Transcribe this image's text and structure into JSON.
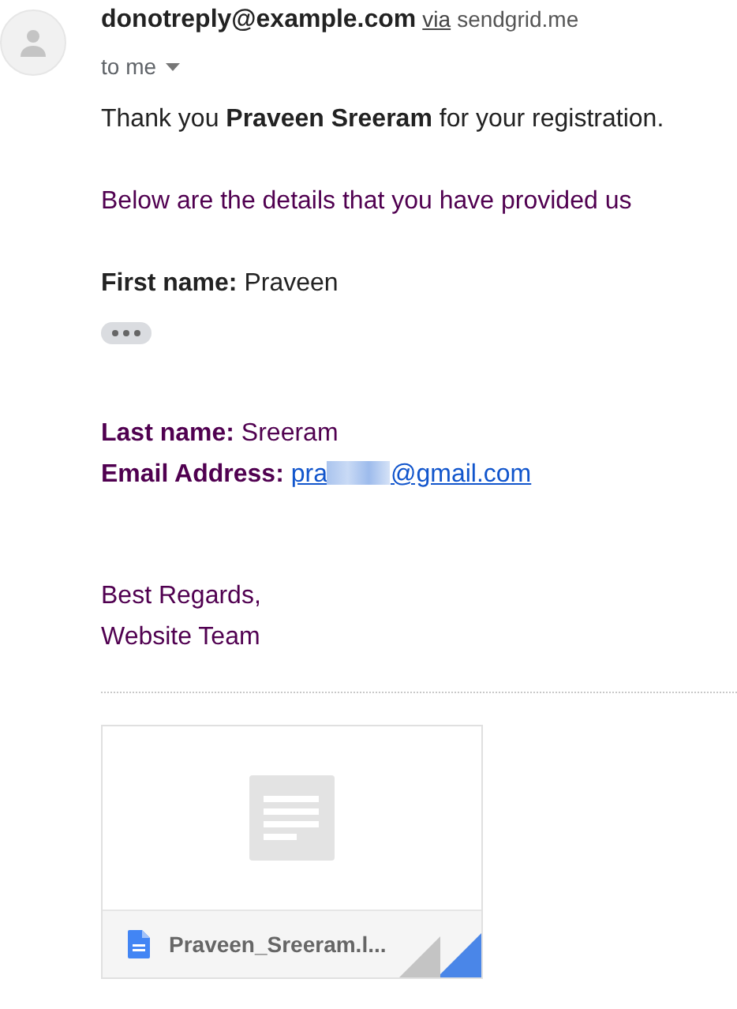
{
  "header": {
    "sender": "donotreply@example.com",
    "via_label": "via",
    "via_domain": "sendgrid.me",
    "recipient": "to me"
  },
  "body": {
    "greeting": "Thank you **Praveen Sreeram** for your registration.",
    "intro": "Below are the details that you have provided us",
    "first_field": {
      "label": "First name:",
      "value": "Praveen"
    },
    "quoted_fields": [
      {
        "kind": "text",
        "label": "Last name:",
        "value": "Sreeram"
      },
      {
        "kind": "link",
        "label": "Email Address:",
        "value_start": "pra",
        "value_end": "@gmail.com"
      }
    ],
    "signature": [
      "Best Regards,",
      "Website Team"
    ]
  },
  "attachments": [
    {
      "kind": "document",
      "filename": "Praveen_Sreeram.l..."
    }
  ]
}
